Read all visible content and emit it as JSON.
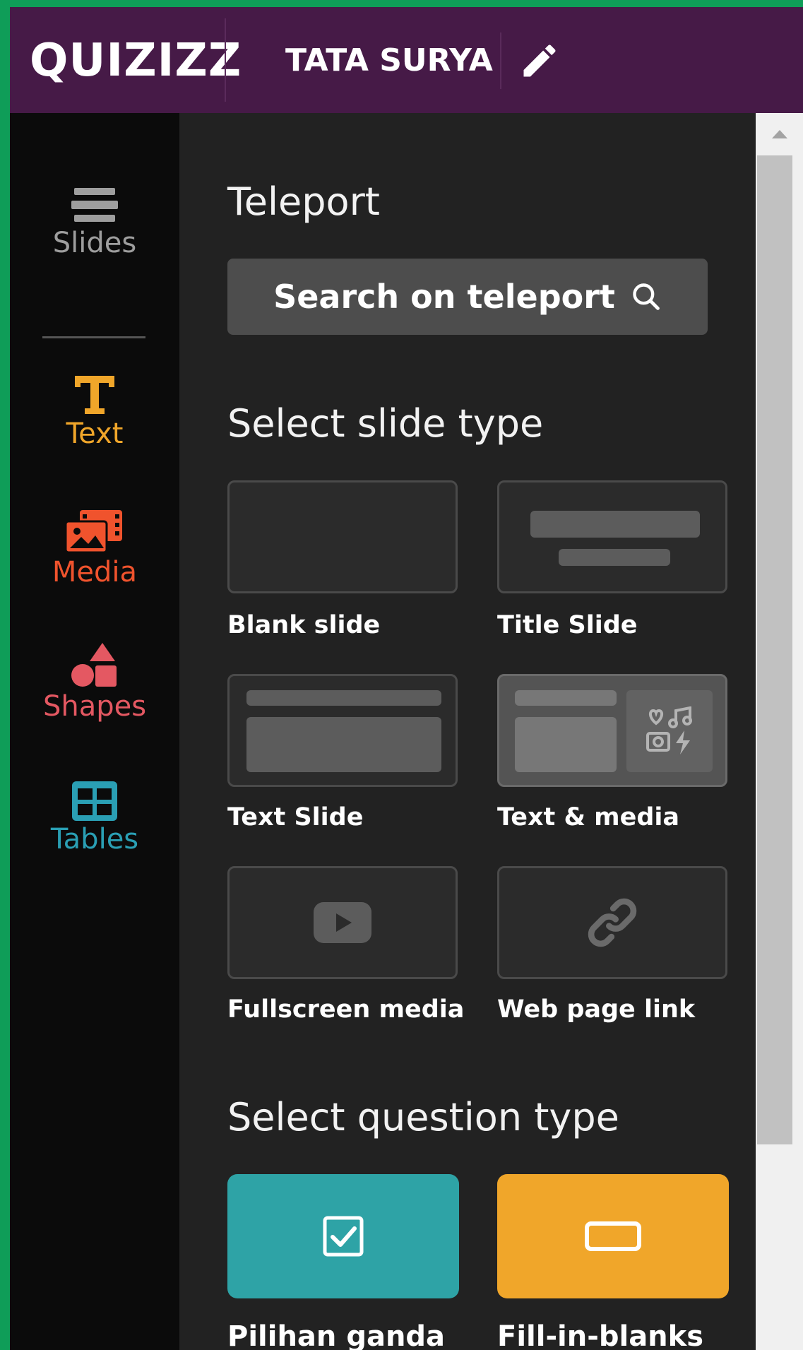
{
  "header": {
    "logo": "QUIZIZZ",
    "title": "TATA SURYA"
  },
  "rail": {
    "items": [
      {
        "label": "Slides",
        "icon": "menu-lines-icon",
        "color": "#9e9e9e"
      },
      {
        "label": "Text",
        "icon": "text-t-icon",
        "color": "#f0a62a"
      },
      {
        "label": "Media",
        "icon": "media-gallery-icon",
        "color": "#f0532d"
      },
      {
        "label": "Shapes",
        "icon": "shapes-icon",
        "color": "#e45862"
      },
      {
        "label": "Tables",
        "icon": "table-grid-icon",
        "color": "#2a9fb4"
      }
    ]
  },
  "panel": {
    "teleport_heading": "Teleport",
    "search_label": "Search on teleport",
    "slide_type_heading": "Select slide type",
    "slide_types": [
      {
        "label": "Blank slide"
      },
      {
        "label": "Title Slide"
      },
      {
        "label": "Text Slide"
      },
      {
        "label": "Text & media"
      },
      {
        "label": "Fullscreen media"
      },
      {
        "label": "Web page link"
      }
    ],
    "question_type_heading": "Select question type",
    "question_types": [
      {
        "label": "Pilihan ganda",
        "color": "#2ea3a6",
        "icon": "checkbox-icon"
      },
      {
        "label": "Fill-in-blanks",
        "color": "#f0a62a",
        "icon": "blank-box-icon"
      }
    ]
  },
  "colors": {
    "header_bg": "#461a47",
    "panel_bg": "#222222",
    "rail_bg": "#0b0b0b",
    "frame_border": "#0f9d58"
  }
}
